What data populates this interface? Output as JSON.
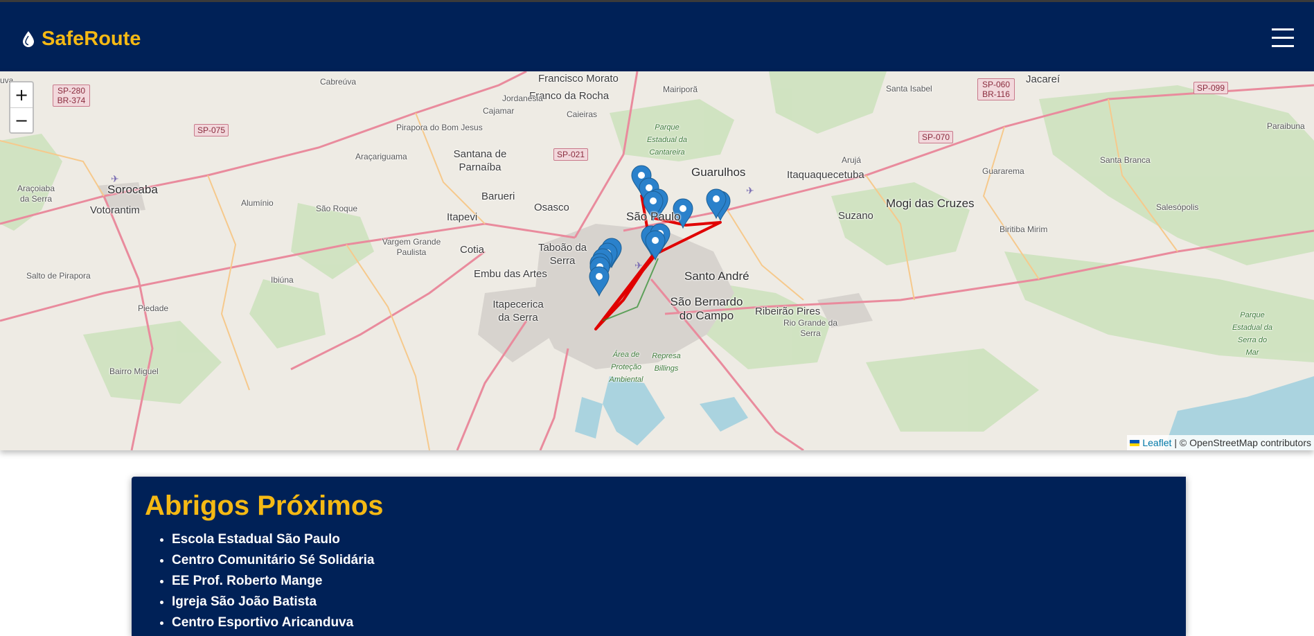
{
  "app": {
    "name": "SafeRoute",
    "brand_color": "#f5b914",
    "header_color": "#002157",
    "logo_icon": "water-drop-icon",
    "menu_icon": "hamburger-menu-icon"
  },
  "map": {
    "zoom_in_label": "+",
    "zoom_out_label": "−",
    "attribution": {
      "leaflet_label": "Leaflet",
      "osm_label": "| © OpenStreetMap contributors"
    },
    "route_color": "#e00000",
    "marker_color": "#2a81cb",
    "places": [
      "Francisco Morato",
      "Franco da Rocha",
      "Mairiporã",
      "Cabreúva",
      "Jordanésia",
      "Cajamar",
      "Caieiras",
      "Pirapora do Bom Jesus",
      "Santana de Parnaíba",
      "Araçariguama",
      "Sorocaba",
      "Araçoiaba da Serra",
      "Votorantim",
      "Alumínio",
      "São Roque",
      "Barueri",
      "Osasco",
      "Itapevi",
      "São Paulo",
      "Guarulhos",
      "Itaquaquecetuba",
      "Arujá",
      "Santa Isabel",
      "Jacareí",
      "Santa Branca",
      "Guararema",
      "Paraibuna",
      "Mogi das Cruzes",
      "Suzano",
      "Salesópolis",
      "Biritiba Mirim",
      "Vargem Grande Paulista",
      "Cotia",
      "Taboão da Serra",
      "Embu das Artes",
      "Santo André",
      "São Bernardo do Campo",
      "Ribeirão Pires",
      "Rio Grande da Serra",
      "Itapecerica da Serra",
      "Salto de Pirapora",
      "Ibiúna",
      "Piedade",
      "Bairro Miguel",
      "Parque Estadual da Cantareira",
      "Parque Estadual da Serra do Mar",
      "Área de Proteção Ambiental",
      "Represa Billings",
      "uva"
    ],
    "roads": [
      "SP-280 BR-374",
      "SP-075",
      "SP-021",
      "SP-060 BR-116",
      "SP-070",
      "SP-099"
    ]
  },
  "shelters": {
    "title": "Abrigos Próximos",
    "items": [
      "Escola Estadual São Paulo",
      "Centro Comunitário Sé Solidária",
      "EE Prof. Roberto Mange",
      "Igreja São João Batista",
      "Centro Esportivo Aricanduva"
    ]
  }
}
